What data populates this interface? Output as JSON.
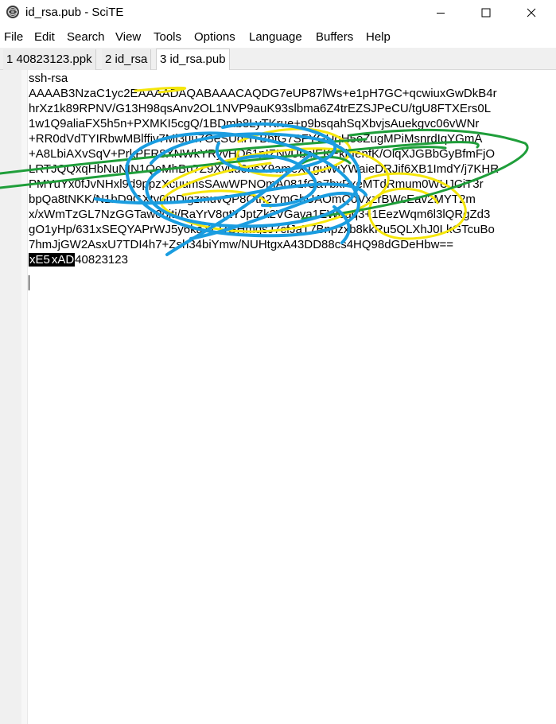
{
  "window": {
    "title": "id_rsa.pub - SciTE",
    "minimize_icon": "minimize-icon",
    "maximize_icon": "maximize-icon",
    "close_icon": "close-icon"
  },
  "menu": [
    "File",
    "Edit",
    "Search",
    "View",
    "Tools",
    "Options",
    "Language",
    "Buffers",
    "Help"
  ],
  "tabs": [
    {
      "label": "1 40823123.ppk",
      "active": false
    },
    {
      "label": "2 id_rsa",
      "active": false
    },
    {
      "label": "3 id_rsa.pub",
      "active": true
    }
  ],
  "editor": {
    "lines": [
      "ssh-rsa",
      "AAAAB3NzaC1yc2EAAAADAQABAAACAQDG7eUP87lWs+e1pH7GC+qcwiuxGwDkB4r",
      "hrXz1k89RPNV/G13H98qsAnv2OL1NVP9auK93slbma6Z4trEZSJPeCU/tgU8FTXErs0L",
      "1w1Q9aliaFX5h5n+PXMKI5cgQ/1BDmb8LyTKrue+p9bsqahSqXbvjsAuekgvc06vWNr",
      "+RR0dVdTYIRbwMBlffjv7Ml3uu7GeSUdHTBbfG7SFYGUqH5eZugMPiMsnrdIqYGmA",
      "+A8LbiAXvSqV+PrkPFR8XNWkYRyvHD61pIZNvUbnlEKEkbfenfK/OlqXJGBbGyBfmFjO",
      "LRTJQQxqHbNuNIN1QeMhBo7Z9Xvuu0nsX9ameXTguWiYWaieDRJif6XB1ImdY/j7KHR",
      "PMYuYx0fJvNHxl9d9ppzXcuumsSAwWPNOmA081fOa7bxPxeMTdRmum0WUJCiT3r",
      "bpQa8tNKK/N1bD9GXtv0mDigzmuvQP8Otn2YmGhUAOmQoVxzrBWcEav2MYT2m",
      "x/xWmTzGL7NzGGTaw0ojti/RaYrV8gtYJptZk2VGava1EWouq3+1EezWqm6l3lQRgZd3",
      "gO1yHp/631xSEQYAPrWJ5y6kaXERGHmqsJ7cfJaT7Bnpzxb8kkRu5QLXhJ0LkGTcuBo",
      "7hmJjGW2AsxU7TDI4h7+Zsh34biYmw/NUHtgxA43DD88cs4HQ98dGDeHbw==",
      "xE5xAD40823123"
    ],
    "selected_tokens": [
      "xE5",
      "xAD"
    ],
    "trailing_text": "40823123"
  },
  "annotations": {
    "scribble_colors": {
      "blue": "#1a9de0",
      "yellow": "#f5e60a",
      "green": "#1f9e3a"
    }
  },
  "app_icon": "scite-app-icon"
}
